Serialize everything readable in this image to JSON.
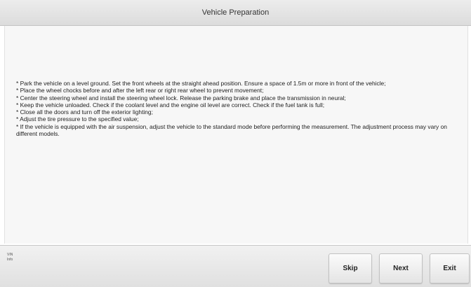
{
  "window": {
    "title": "Vehicle Preparation"
  },
  "instructions": [
    "* Park the vehicle on a level ground. Set the front wheels at the straight ahead position. Ensure a space of 1.5m or more in front of the vehicle;",
    "* Place the wheel chocks before and after the left rear or right rear wheel to prevent movement;",
    "* Center the steering wheel and install the steering wheel lock. Release the parking brake and place the transmission in neural;",
    "* Keep the vehicle unloaded. Check if the coolant level and the engine oil level are correct. Check if the fuel tank is full;",
    "* Close all the doors and turn off the exterior lighting;",
    "* Adjust the tire pressure to the specified value;",
    "* If the vehicle is equipped with the air suspension, adjust the vehicle to the standard mode before performing the measurement. The adjustment process may vary on different models."
  ],
  "footer": {
    "vin_label": "VIN",
    "info_label": "Info"
  },
  "buttons": {
    "skip": "Skip",
    "next": "Next",
    "exit": "Exit"
  }
}
